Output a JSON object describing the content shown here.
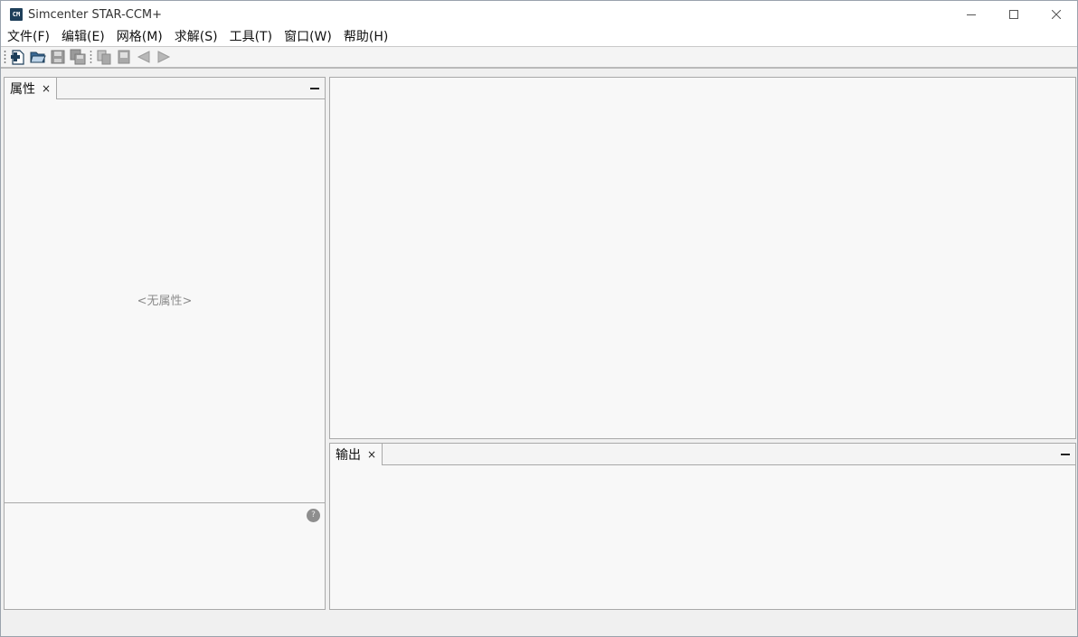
{
  "window": {
    "title": "Simcenter STAR-CCM+",
    "icon_text": "CM"
  },
  "menu": {
    "items": [
      {
        "label": "文件(F)"
      },
      {
        "label": "编辑(E)"
      },
      {
        "label": "网格(M)"
      },
      {
        "label": "求解(S)"
      },
      {
        "label": "工具(T)"
      },
      {
        "label": "窗口(W)"
      },
      {
        "label": "帮助(H)"
      }
    ]
  },
  "toolbar": {
    "buttons": [
      {
        "icon": "new-simulation-icon",
        "enabled": true
      },
      {
        "icon": "open-folder-icon",
        "enabled": true
      },
      {
        "icon": "save-icon",
        "enabled": false
      },
      {
        "icon": "save-as-icon",
        "enabled": false
      },
      {
        "icon": "copy-icon",
        "enabled": false
      },
      {
        "icon": "paste-icon",
        "enabled": false
      },
      {
        "icon": "back-arrow-icon",
        "enabled": false
      },
      {
        "icon": "forward-arrow-icon",
        "enabled": false
      }
    ]
  },
  "properties_panel": {
    "tab_label": "属性",
    "close_glyph": "×",
    "empty_text": "<无属性>",
    "help_glyph": "?"
  },
  "output_panel": {
    "tab_label": "输出",
    "close_glyph": "×"
  },
  "colors": {
    "panel_bg": "#f8f8f8",
    "border": "#a9a9a9",
    "disabled_icon": "#8c8c8c",
    "accent_icon": "#1e3f5a"
  }
}
